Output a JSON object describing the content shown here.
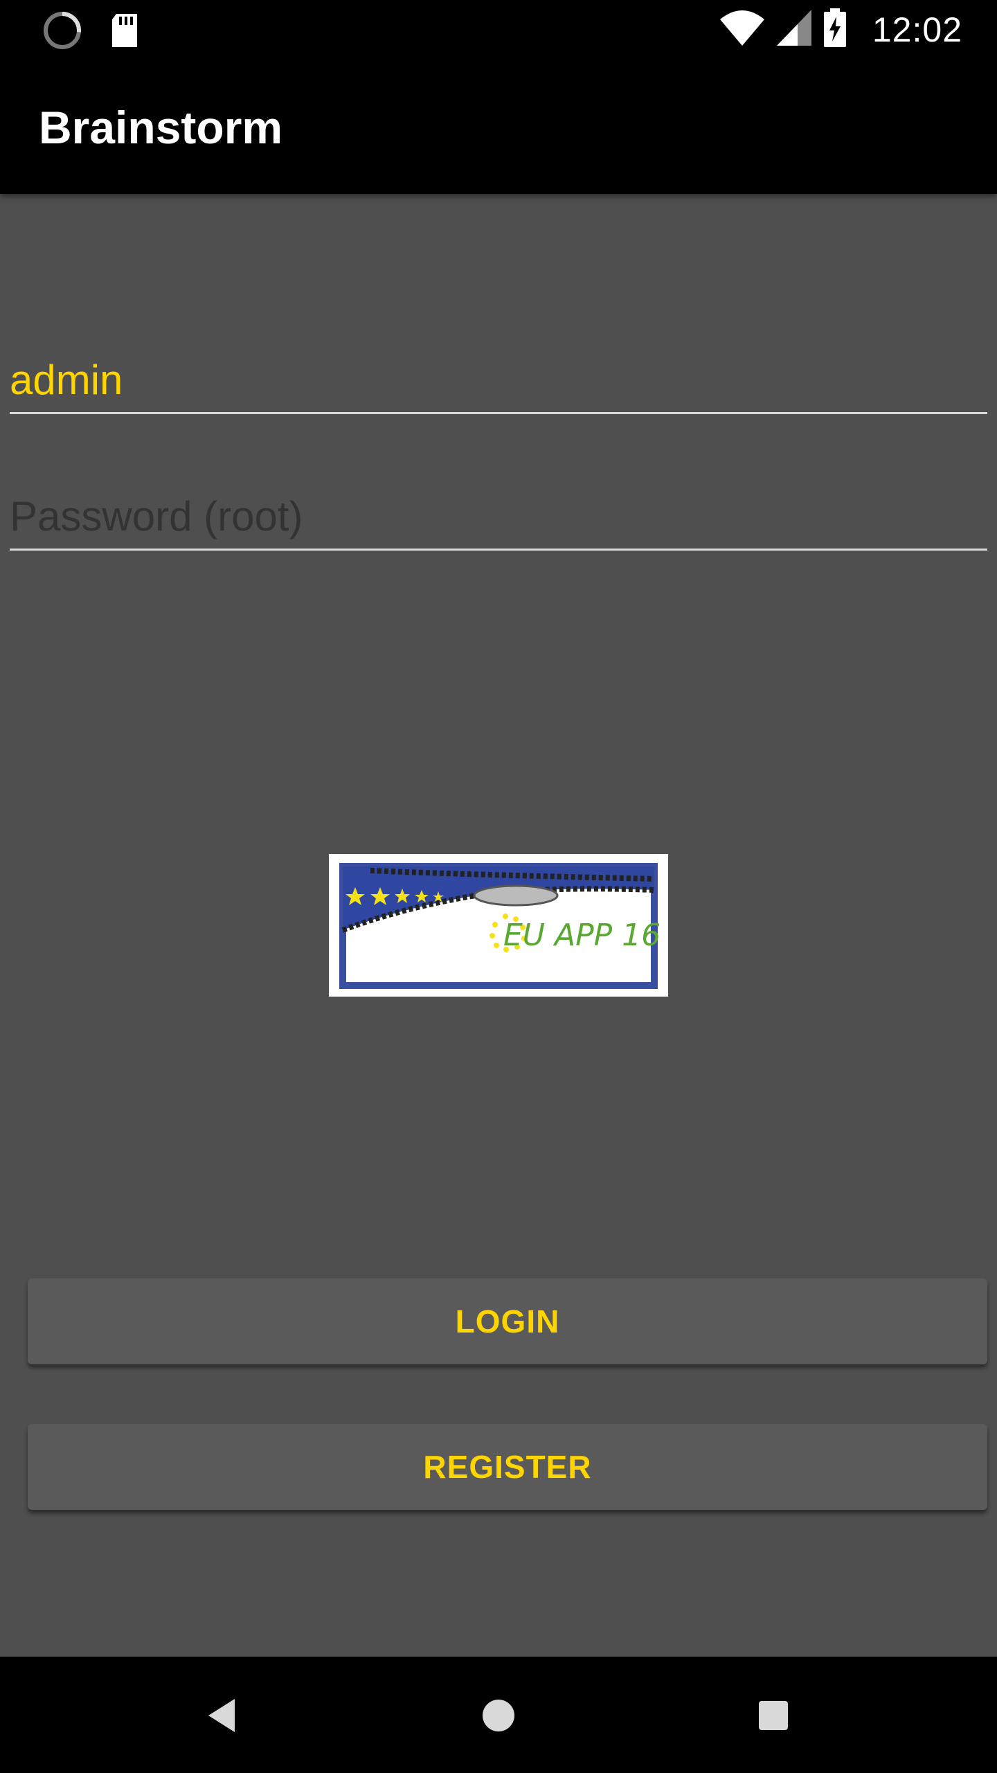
{
  "status_bar": {
    "time": "12:02",
    "left_icons": [
      "loading-spinner-icon",
      "sd-card-icon"
    ],
    "right_icons": [
      "wifi-icon",
      "cell-signal-icon",
      "battery-charging-icon"
    ]
  },
  "app_bar": {
    "title": "Brainstorm"
  },
  "login_form": {
    "username_value": "admin",
    "password_placeholder": "Password (root)"
  },
  "logo": {
    "text": "EU APP 16",
    "icon": "eu-app-logo"
  },
  "buttons": {
    "login_label": "LOGIN",
    "register_label": "REGISTER"
  },
  "nav_bar": {
    "icons": [
      "back-icon",
      "home-icon",
      "recents-icon"
    ]
  },
  "colors": {
    "accent": "#ffd500",
    "background": "#4f4f4f",
    "bar": "#000000",
    "button": "#5a5a5a"
  }
}
